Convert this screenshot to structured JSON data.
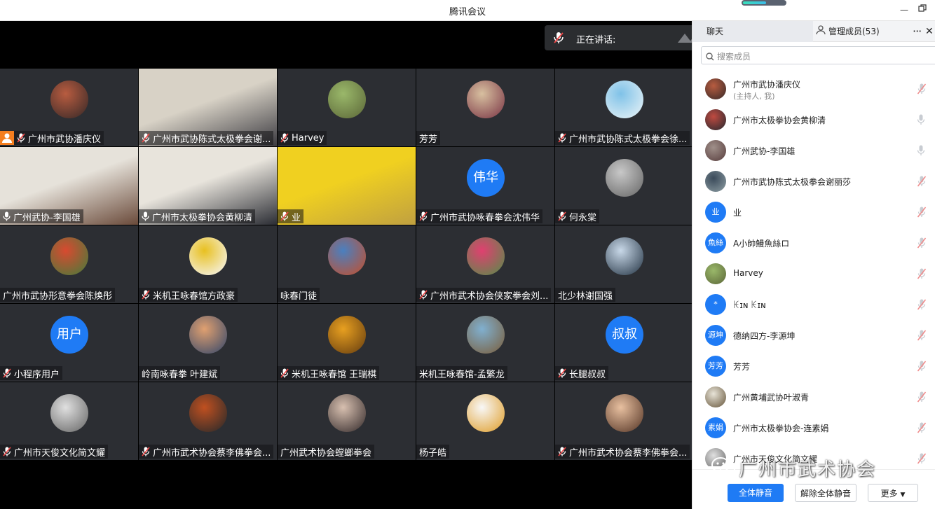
{
  "window": {
    "title": "腾讯会议",
    "network_level": 0.55,
    "accent": "#1f7bf5"
  },
  "speaking": {
    "label": "正在讲话:"
  },
  "tiles": [
    {
      "name": "广州市武协潘庆仪",
      "mic": "muted",
      "kind": "avatar",
      "host": true,
      "colors": [
        "#b85c40",
        "#3a2a28"
      ]
    },
    {
      "name": "广州市武协陈式太极拳会谢...",
      "mic": "muted",
      "kind": "video",
      "colors": [
        "#d8d2c6",
        "#3b3a40"
      ]
    },
    {
      "name": "Harvey",
      "mic": "muted",
      "kind": "avatar",
      "colors": [
        "#9ab86a",
        "#5e6a3a"
      ]
    },
    {
      "name": "芳芳",
      "mic": "none",
      "kind": "avatar",
      "colors": [
        "#d8c0a0",
        "#7d3a48"
      ]
    },
    {
      "name": "广州市武协陈式太极拳会徐...",
      "mic": "muted",
      "kind": "avatar",
      "colors": [
        "#7fc2e8",
        "#e8f2f6"
      ]
    },
    {
      "name": "广州武协-李国雄",
      "mic": "on",
      "kind": "video",
      "colors": [
        "#e6e2da",
        "#6a4a3a"
      ]
    },
    {
      "name": "广州市太极拳协会黄柳清",
      "mic": "on",
      "kind": "video",
      "colors": [
        "#e8e4dc",
        "#2b2d34"
      ]
    },
    {
      "name": "业",
      "mic": "muted",
      "kind": "video",
      "colors": [
        "#f0d020",
        "#c0a040"
      ]
    },
    {
      "name": "广州市武协咏春拳会沈伟华",
      "mic": "muted",
      "kind": "text",
      "text": "伟华"
    },
    {
      "name": "何永棠",
      "mic": "muted",
      "kind": "avatar",
      "colors": [
        "#c8c8c8",
        "#6a6a6a"
      ]
    },
    {
      "name": "广州市武协形意拳会陈焕彤",
      "mic": "none",
      "kind": "avatar",
      "colors": [
        "#d84a30",
        "#4a7a3a"
      ]
    },
    {
      "name": "米机王咏春馆方政豪",
      "mic": "muted",
      "kind": "avatar",
      "colors": [
        "#e8c020",
        "#f6f6f6"
      ]
    },
    {
      "name": "咏春门徒",
      "mic": "none",
      "kind": "avatar",
      "colors": [
        "#4a80c0",
        "#c05030"
      ]
    },
    {
      "name": "广州市武术协会侠家拳会刘...",
      "mic": "muted",
      "kind": "avatar",
      "colors": [
        "#e04070",
        "#5a8a4a"
      ]
    },
    {
      "name": "北少林谢国强",
      "mic": "none",
      "kind": "avatar",
      "colors": [
        "#c8d8e8",
        "#2a3a4a"
      ]
    },
    {
      "name": "小程序用户",
      "mic": "muted",
      "kind": "text",
      "text": "用户"
    },
    {
      "name": "岭南咏春拳 叶建斌",
      "mic": "none",
      "kind": "avatar",
      "colors": [
        "#e0a070",
        "#3a4a6a"
      ]
    },
    {
      "name": "米机王咏春馆 王瑞棋",
      "mic": "muted",
      "kind": "avatar",
      "colors": [
        "#e8a020",
        "#6a4010"
      ]
    },
    {
      "name": "米机王咏春馆-孟繁龙",
      "mic": "none",
      "kind": "avatar",
      "colors": [
        "#80b0d0",
        "#7a6040"
      ]
    },
    {
      "name": "长腿叔叔",
      "mic": "muted",
      "kind": "text",
      "text": "叔叔"
    },
    {
      "name": "广州市天俊文化简文耀",
      "mic": "muted",
      "kind": "avatar",
      "colors": [
        "#e0e0e0",
        "#6a6a6a"
      ]
    },
    {
      "name": "广州市武术协会蔡李佛拳会...",
      "mic": "muted",
      "kind": "avatar",
      "colors": [
        "#c05020",
        "#2a2a2a"
      ]
    },
    {
      "name": "广州武术协会螳螂拳会",
      "mic": "none",
      "kind": "avatar",
      "colors": [
        "#d8c0b0",
        "#3a3030"
      ]
    },
    {
      "name": "杨子皓",
      "mic": "none",
      "kind": "avatar",
      "colors": [
        "#f8f8f8",
        "#e0a030"
      ]
    },
    {
      "name": "广州市武术协会蔡李佛拳会...",
      "mic": "muted",
      "kind": "avatar",
      "colors": [
        "#e8c0a0",
        "#5a3a2a"
      ]
    }
  ],
  "panel": {
    "tab_chat": "聊天",
    "tab_members": "管理成员(53)",
    "search_placeholder": "搜索成员",
    "members": [
      {
        "name": "广州市武协潘庆仪",
        "sub": "(主持人, 我)",
        "mic": "muted",
        "kind": "avatar",
        "colors": [
          "#b85c40",
          "#3a2a28"
        ]
      },
      {
        "name": "广州市太极拳协会黄柳清",
        "mic": "on",
        "kind": "avatar",
        "colors": [
          "#c04a40",
          "#2a2a30"
        ]
      },
      {
        "name": "广州武协-李国雄",
        "mic": "on",
        "kind": "avatar",
        "colors": [
          "#a0908a",
          "#5a4040"
        ]
      },
      {
        "name": "广州市武协陈式太极拳会谢丽莎",
        "mic": "muted",
        "kind": "avatar",
        "colors": [
          "#3a4a5a",
          "#8a9aa0"
        ]
      },
      {
        "name": "业",
        "mic": "muted",
        "kind": "text",
        "text": "业"
      },
      {
        "name": "A小帥鰻魚絲ロ",
        "mic": "muted",
        "kind": "text",
        "text": "魚絲"
      },
      {
        "name": "Harvey",
        "mic": "muted",
        "kind": "avatar",
        "colors": [
          "#9ab86a",
          "#5e6a3a"
        ]
      },
      {
        "name": "ꀘɪɴ ꀘɪɴ",
        "mic": "muted",
        "kind": "text",
        "text": "*"
      },
      {
        "name": "德纳四方-李源坤",
        "mic": "muted",
        "kind": "text",
        "text": "源坤"
      },
      {
        "name": "芳芳",
        "mic": "muted",
        "kind": "text",
        "text": "芳芳"
      },
      {
        "name": "广州黄埔武协叶淑青",
        "mic": "muted",
        "kind": "avatar",
        "colors": [
          "#e8e4d8",
          "#6a5a40"
        ]
      },
      {
        "name": "广州市太极拳协会-连素娟",
        "mic": "muted",
        "kind": "text",
        "text": "素娟"
      },
      {
        "name": "广州市天俊文化简文耀",
        "mic": "muted",
        "kind": "avatar",
        "colors": [
          "#e0e0e0",
          "#6a6a6a"
        ]
      }
    ],
    "mute_all": "全体静音",
    "unmute_all": "解除全体静音",
    "more": "更多"
  },
  "watermark": "广州市武术协会"
}
